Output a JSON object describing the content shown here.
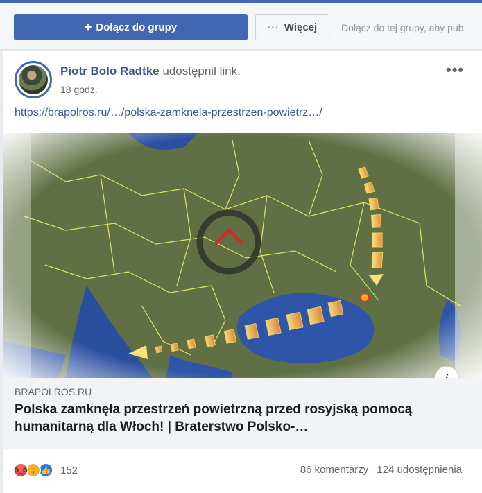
{
  "group_bar": {
    "join_label": "Dołącz do grupy",
    "join_icon": "plus-icon",
    "more_label": "Więcej",
    "more_icon": "ellipsis-icon",
    "join_text": "Dołącz do tej grupy, aby pub"
  },
  "post": {
    "author_name": "Piotr Bolo Radtke",
    "action_text": "udostępnił link.",
    "time": "18 godz.",
    "link_text": "https://brapolros.ru/…/polska-zamknela-przestrzen-powietrz…/",
    "menu_icon": "more-options-icon",
    "preview": {
      "domain": "BRAPOLROS.RU",
      "title": "Polska zamknęła przestrzeń powietrzną przed rosyjską pomocą humanitarną dla Włoch! | Braterstwo Polsko-…",
      "info_glyph": "i"
    },
    "reactions": {
      "icons": [
        "angry-reaction-icon",
        "sad-reaction-icon",
        "like-reaction-icon"
      ],
      "count": "152"
    },
    "comments": "86 komentarzy",
    "shares": "124 udostępnienia"
  },
  "colors": {
    "brand_blue": "#4267b2",
    "link_blue": "#385898",
    "secondary_text": "#606770"
  }
}
